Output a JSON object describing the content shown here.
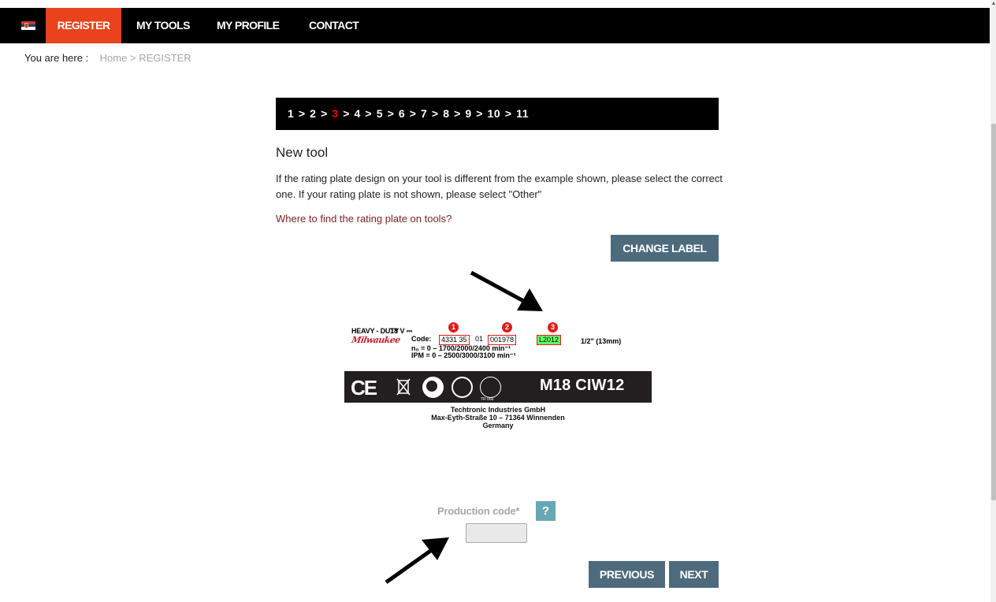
{
  "nav": {
    "flag_icon": "serbia-flag-icon",
    "items": [
      {
        "label": "REGISTER",
        "active": true
      },
      {
        "label": "MY TOOLS"
      },
      {
        "label": "MY PROFILE"
      },
      {
        "label": "CONTACT"
      }
    ],
    "active_color": "#e8431d"
  },
  "breadcrumb": {
    "prefix": "You are here :",
    "home": "Home",
    "separator": ">",
    "current": "REGISTER"
  },
  "steps": {
    "items": [
      "1",
      "2",
      "3",
      "4",
      "5",
      "6",
      "7",
      "8",
      "9",
      "10",
      "11"
    ],
    "separator": ">",
    "current": "3",
    "current_color": "#ff0000"
  },
  "page": {
    "heading": "New tool",
    "description": "If the rating plate design on your tool is different from the example shown, please select the correct one. If your rating plate is not shown, please select \"Other\"",
    "find_link": "Where to find the rating plate on tools?",
    "change_label_button": "CHANGE LABEL"
  },
  "plate": {
    "heavy_duty": "HEAVY - DUTY",
    "brand": "Milwaukee",
    "voltage": "18 V ⎓",
    "markers": [
      "1",
      "2",
      "3"
    ],
    "code_label": "Code:",
    "code_1": "4331 35",
    "code_mid": "01",
    "code_2": "001978",
    "code_3": "L2012",
    "chuck_size": "1/2\" (13mm)",
    "speed_line": "n₀ = 0 – 1700/2000/2400 min⁻¹",
    "ipm_line": "IPM = 0 – 2500/3000/3100 min⁻¹",
    "cert_mark": "CE",
    "tr_text": "TR 066",
    "model": "M18 CIW12",
    "address_1": "Techtronic Industries GmbH",
    "address_2": "Max-Eyth-Straße 10 – 71364 Winnenden",
    "address_3": "Germany",
    "highlight_color": "#66ff66"
  },
  "form": {
    "production_code_label": "Production code*",
    "help_label": "?",
    "production_code_value": "",
    "production_code_placeholder": ""
  },
  "buttons": {
    "previous": "PREVIOUS",
    "next": "NEXT",
    "color": "#4d6b7d"
  }
}
